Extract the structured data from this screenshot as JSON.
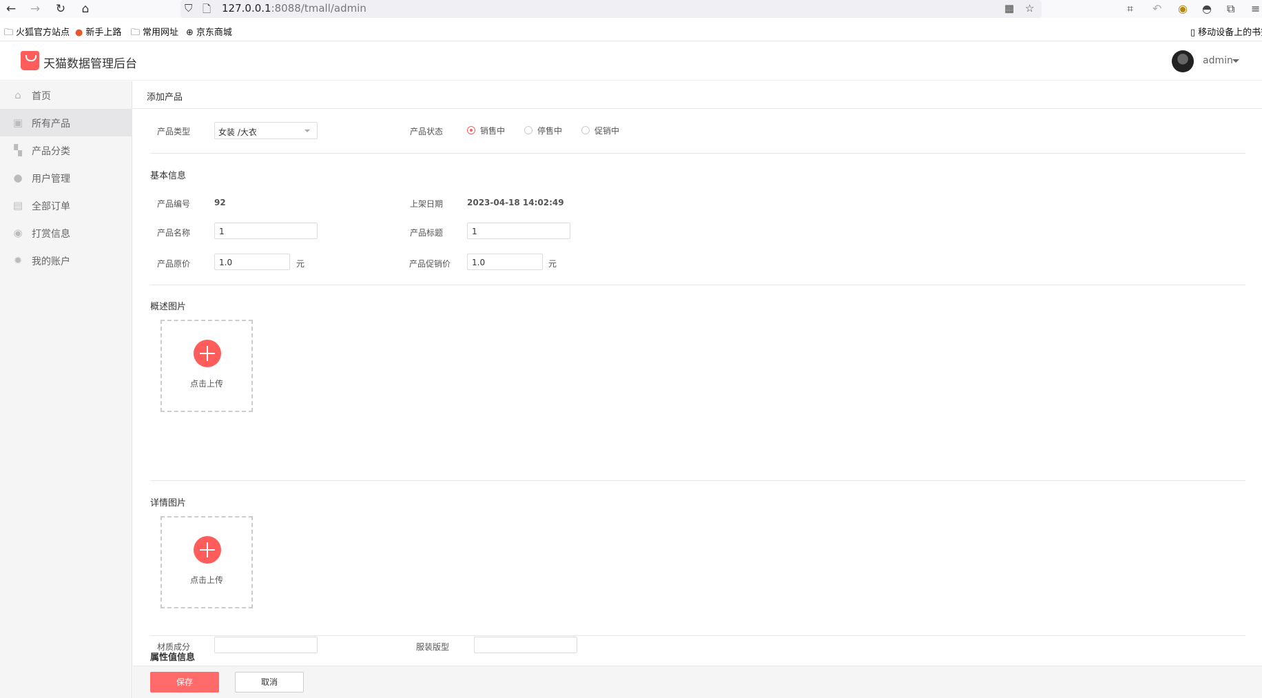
{
  "browser": {
    "url_host": "127.0.0.1",
    "url_rest": ":8088/tmall/admin",
    "bookmarks": [
      "火狐官方站点",
      "新手上路",
      "常用网址",
      "京东商城"
    ],
    "mobile_bookmarks": "移动设备上的书签"
  },
  "header": {
    "app_title": "天猫数据管理后台",
    "user_name": "admin"
  },
  "sidebar": {
    "items": [
      {
        "label": "首页",
        "icon": "home-icon",
        "active": false
      },
      {
        "label": "所有产品",
        "icon": "product-icon",
        "active": true
      },
      {
        "label": "产品分类",
        "icon": "category-icon",
        "active": false
      },
      {
        "label": "用户管理",
        "icon": "user-icon",
        "active": false
      },
      {
        "label": "全部订单",
        "icon": "order-icon",
        "active": false
      },
      {
        "label": "打赏信息",
        "icon": "reward-icon",
        "active": false
      },
      {
        "label": "我的账户",
        "icon": "settings-icon",
        "active": false
      }
    ]
  },
  "page": {
    "title": "添加产品",
    "type_label": "产品类型",
    "type_value": "女装 /大衣",
    "status_label": "产品状态",
    "status_options": [
      "销售中",
      "停售中",
      "促销中"
    ],
    "status_selected": "销售中"
  },
  "basic": {
    "title": "基本信息",
    "id_label": "产品编号",
    "id_value": "92",
    "date_label": "上架日期",
    "date_value": "2023-04-18 14:02:49",
    "name_label": "产品名称",
    "name_value": "1",
    "subtitle_label": "产品标题",
    "subtitle_value": "1",
    "price_label": "产品原价",
    "price_value": "1.0",
    "sale_price_label": "产品促销价",
    "sale_price_value": "1.0",
    "unit": "元"
  },
  "images": {
    "overview_title": "概述图片",
    "detail_title": "详情图片",
    "upload_label": "点击上传"
  },
  "attributes": {
    "title": "属性值信息",
    "material_label": "材质成分",
    "material_value": "",
    "fit_label": "服装版型",
    "fit_value": ""
  },
  "footer": {
    "save_label": "保存",
    "cancel_label": "取消"
  },
  "colors": {
    "accent": "#ff5c5c",
    "sidebar_bg": "#f5f5f5"
  }
}
